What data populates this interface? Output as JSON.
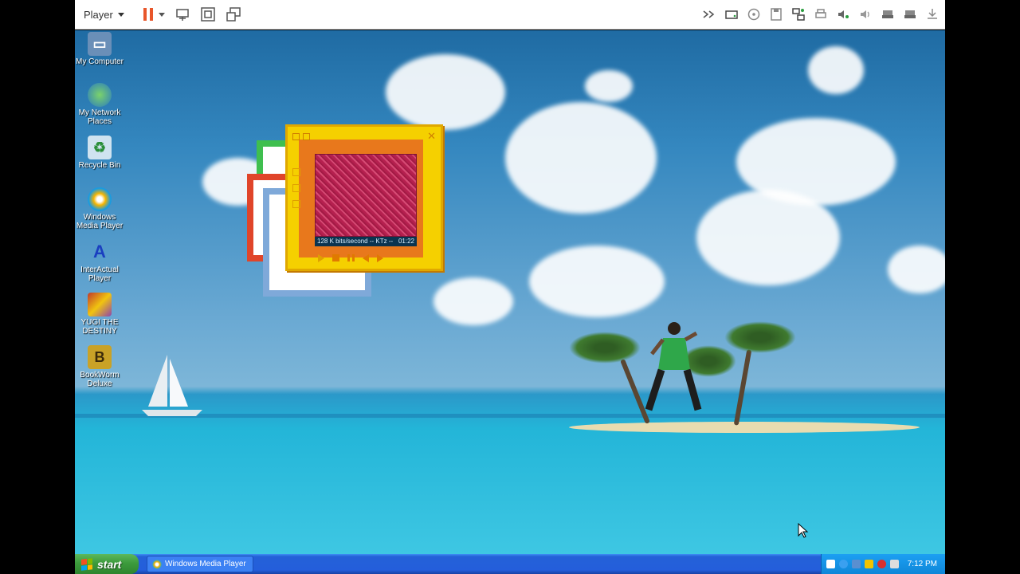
{
  "vm_toolbar": {
    "menu_label": "Player",
    "icons": [
      "pause-icon",
      "send-ctrl-alt-del-icon",
      "fullscreen-icon",
      "unity-icon",
      "forward-icon",
      "hdd-icon",
      "cd-icon",
      "floppy-icon",
      "network-icon",
      "printer-icon",
      "sound-icon",
      "speaker-icon",
      "usb-icon",
      "usb2-icon",
      "download-icon"
    ]
  },
  "desktop": {
    "icons": [
      {
        "label": "My Computer",
        "icon": "computer-icon"
      },
      {
        "label": "My Network Places",
        "icon": "network-places-icon"
      },
      {
        "label": "Recycle Bin",
        "icon": "recycle-bin-icon"
      },
      {
        "label": "Windows Media Player",
        "icon": "media-player-icon"
      },
      {
        "label": "InterActual Player",
        "icon": "interactual-icon"
      },
      {
        "label": "YUGI THE DESTINY",
        "icon": "game-icon"
      },
      {
        "label": "BookWorm Deluxe",
        "icon": "bookworm-icon"
      }
    ]
  },
  "media_player": {
    "status_text": "128 K bits/second -- KTz --",
    "time": "01:22"
  },
  "taskbar": {
    "start_label": "start",
    "task_label": "Windows Media Player",
    "clock": "7:12 PM"
  },
  "colors": {
    "taskbar": "#245edb",
    "start": "#3c9b3c",
    "skin_yellow": "#f5d000",
    "skin_orange": "#e8781c",
    "pause": "#e8562a"
  }
}
